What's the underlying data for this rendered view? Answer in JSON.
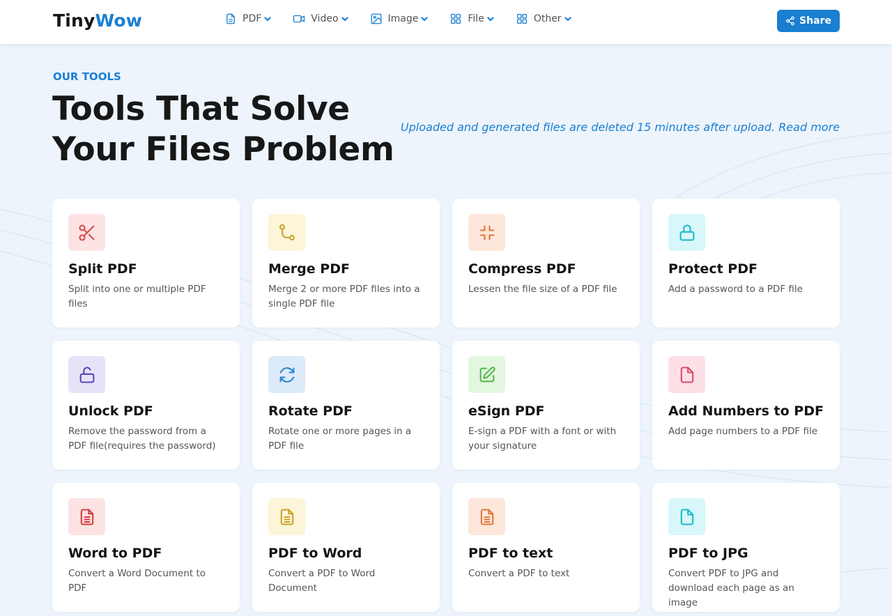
{
  "header": {
    "logo_part1": "Tiny",
    "logo_part2": "Wow",
    "nav": [
      {
        "label": "PDF",
        "icon": "document-icon"
      },
      {
        "label": "Video",
        "icon": "video-camera-icon"
      },
      {
        "label": "Image",
        "icon": "image-icon"
      },
      {
        "label": "File",
        "icon": "grid-icon"
      },
      {
        "label": "Other",
        "icon": "grid-icon"
      }
    ],
    "share_label": "Share"
  },
  "hero": {
    "eyebrow": "OUR TOOLS",
    "title_line1": "Tools That Solve",
    "title_line2": "Your Files Problem",
    "notice": "Uploaded and generated files are deleted 15 minutes after upload.",
    "read_more": "Read more"
  },
  "tools": [
    {
      "title": "Split PDF",
      "desc": "Split into one or multiple PDF files",
      "icon": "scissors-icon",
      "color": "#d94a4a",
      "bg": "#fde3e3"
    },
    {
      "title": "Merge PDF",
      "desc": "Merge 2 or more PDF files into a single PDF file",
      "icon": "merge-icon",
      "color": "#c9a227",
      "bg": "#fdf5d9"
    },
    {
      "title": "Compress PDF",
      "desc": "Lessen the file size of a PDF file",
      "icon": "compress-icon",
      "color": "#e0773b",
      "bg": "#fde6da"
    },
    {
      "title": "Protect PDF",
      "desc": "Add a password to a PDF file",
      "icon": "lock-icon",
      "color": "#19b9c9",
      "bg": "#d8f7fa"
    },
    {
      "title": "Unlock PDF",
      "desc": "Remove the password from a PDF file(requires the password)",
      "icon": "unlock-icon",
      "color": "#5a43b8",
      "bg": "#e6e3f9"
    },
    {
      "title": "Rotate PDF",
      "desc": "Rotate one or more pages in a PDF file",
      "icon": "rotate-icon",
      "color": "#2a86cf",
      "bg": "#dceaf9"
    },
    {
      "title": "eSign PDF",
      "desc": "E-sign a PDF with a font or with your signature",
      "icon": "edit-icon",
      "color": "#57b84e",
      "bg": "#e3f6e0"
    },
    {
      "title": "Add Numbers to PDF",
      "desc": "Add page numbers to a PDF file",
      "icon": "file-icon",
      "color": "#d94a6a",
      "bg": "#fde0e6"
    },
    {
      "title": "Word to PDF",
      "desc": "Convert a Word Document to PDF",
      "icon": "file-text-icon",
      "color": "#d23d3d",
      "bg": "#fde3e3"
    },
    {
      "title": "PDF to Word",
      "desc": "Convert a PDF to Word Document",
      "icon": "file-text-icon",
      "color": "#c9a227",
      "bg": "#fdf5d9"
    },
    {
      "title": "PDF to text",
      "desc": "Convert a PDF to text",
      "icon": "file-text-icon",
      "color": "#e0773b",
      "bg": "#fde6da"
    },
    {
      "title": "PDF to JPG",
      "desc": "Convert PDF to JPG and download each page as an image",
      "icon": "file-icon",
      "color": "#19b9c9",
      "bg": "#d8f7fa"
    }
  ]
}
